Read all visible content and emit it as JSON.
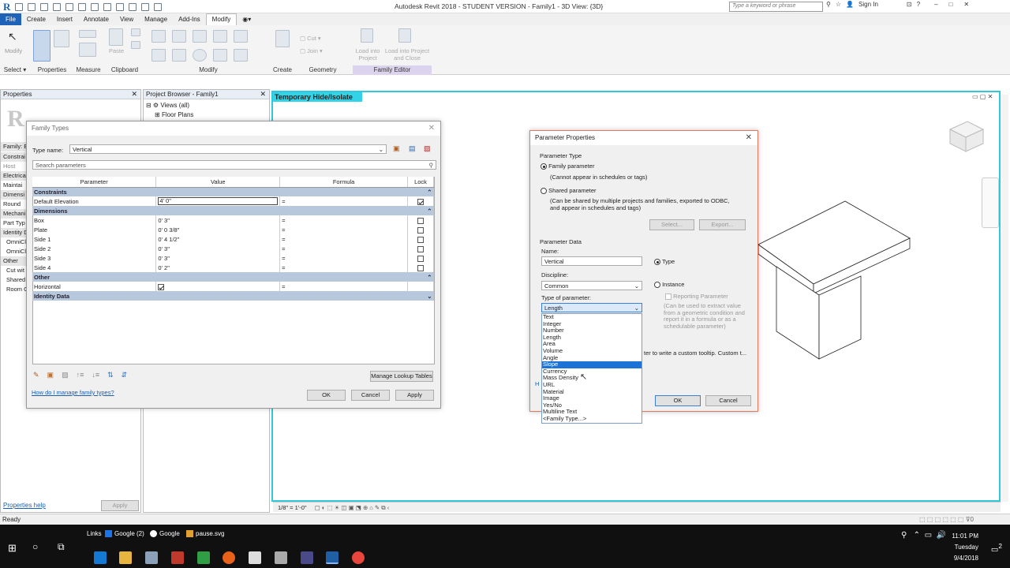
{
  "title_bar": {
    "window_title": "Autodesk Revit 2018 - STUDENT VERSION -   Family1 - 3D View: {3D}",
    "search_placeholder": "Type a keyword or phrase",
    "sign_in": "Sign In"
  },
  "menu": [
    "File",
    "Create",
    "Insert",
    "Annotate",
    "View",
    "Manage",
    "Add-Ins",
    "Modify"
  ],
  "ribbon": {
    "groups": [
      "Select",
      "Properties",
      "Measure",
      "Clipboard",
      "Modify",
      "Create",
      "Geometry",
      "Family Editor"
    ],
    "labels": {
      "modify": "Modify",
      "paste": "Paste",
      "cut": "Cut",
      "join": "Join",
      "load_into_project": "Load into Project",
      "load_close": "Load into Project and Close"
    }
  },
  "properties_panel": {
    "title": "Properties",
    "rows": [
      "Family: E",
      "Constrai",
      "Host",
      "Electrica",
      "Maintai",
      "Dimensi",
      "Round",
      "Mechani",
      "Part Typ",
      "Identity D",
      "OmniCl",
      "OmniCl",
      "Other",
      "Cut wit",
      "Shared",
      "Room C"
    ],
    "help_link": "Properties help",
    "apply": "Apply"
  },
  "project_browser": {
    "title": "Project Browser - Family1",
    "items": [
      "Views (all)",
      "Floor Plans"
    ]
  },
  "view": {
    "banner": "Temporary Hide/Isolate",
    "scale": "1/8\" = 1'-0\""
  },
  "family_types": {
    "title": "Family Types",
    "type_name_label": "Type name:",
    "type_name": "Vertical",
    "search_placeholder": "Search parameters",
    "columns": [
      "Parameter",
      "Value",
      "Formula",
      "Lock"
    ],
    "groups": [
      {
        "name": "Constraints",
        "rows": [
          {
            "param": "Default Elevation",
            "value": "4'  0\"",
            "formula": "=",
            "lock": true
          }
        ]
      },
      {
        "name": "Dimensions",
        "rows": [
          {
            "param": "Box",
            "value": "0'  3\"",
            "formula": "=",
            "lock": false
          },
          {
            "param": "Plate",
            "value": "0'  0 3/8\"",
            "formula": "=",
            "lock": false
          },
          {
            "param": "Side 1",
            "value": "0'  4 1/2\"",
            "formula": "=",
            "lock": false
          },
          {
            "param": "Side 2",
            "value": "0'  3\"",
            "formula": "=",
            "lock": false
          },
          {
            "param": "Side 3",
            "value": "0'  3\"",
            "formula": "=",
            "lock": false
          },
          {
            "param": "Side 4",
            "value": "0'  2\"",
            "formula": "=",
            "lock": false
          }
        ]
      },
      {
        "name": "Other",
        "rows": [
          {
            "param": "Horizontal",
            "value": "check",
            "formula": "=",
            "lock": null
          }
        ]
      },
      {
        "name": "Identity Data",
        "rows": []
      }
    ],
    "manage_lookup": "Manage Lookup Tables",
    "help_link": "How do I manage family types?",
    "ok": "OK",
    "cancel": "Cancel",
    "apply": "Apply"
  },
  "param_props": {
    "title": "Parameter Properties",
    "param_type_label": "Parameter Type",
    "family_param": "Family parameter",
    "family_param_note": "(Cannot appear in schedules or tags)",
    "shared_param": "Shared parameter",
    "shared_param_note": "(Can be shared by multiple projects and families, exported to ODBC, and appear in schedules and tags)",
    "select_btn": "Select...",
    "export_btn": "Export...",
    "param_data_label": "Parameter Data",
    "name_label": "Name:",
    "name_value": "Vertical",
    "type_radio": "Type",
    "discipline_label": "Discipline:",
    "discipline_value": "Common",
    "instance_radio": "Instance",
    "reporting": "Reporting Parameter",
    "reporting_note": "(Can be used to extract value from a geometric condition and report it in a formula or as a schedulable parameter)",
    "type_of_param_label": "Type of parameter:",
    "type_of_param_value": "Length",
    "tooltip_text": "ter to write a custom tooltip. Custom t...",
    "options": [
      "Text",
      "Integer",
      "Number",
      "Length",
      "Area",
      "Volume",
      "Angle",
      "Slope",
      "Currency",
      "Mass Density",
      "URL",
      "Material",
      "Image",
      "Yes/No",
      "Multiline Text",
      "<Family Type...>"
    ],
    "selected_option": "Slope",
    "ok": "OK",
    "cancel": "Cancel"
  },
  "status": "Ready",
  "taskbar": {
    "items": [
      "Links",
      "Google (2)",
      "Google",
      "pause.svg"
    ],
    "time": "11:01 PM",
    "day": "Tuesday",
    "date": "9/4/2018",
    "notifications": "2"
  }
}
